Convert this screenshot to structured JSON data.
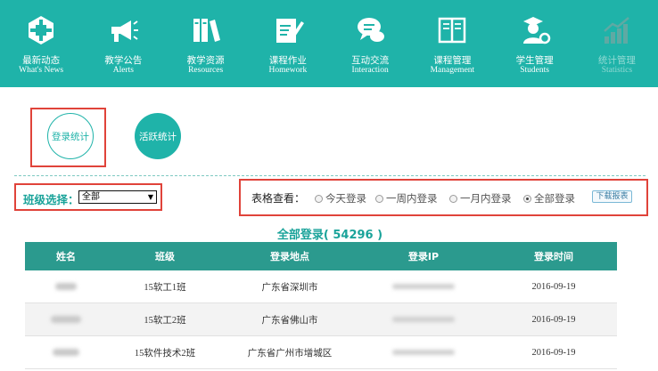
{
  "nav": [
    {
      "cn": "最新动态",
      "en": "What's News",
      "icon": "news-icon",
      "active": true
    },
    {
      "cn": "教学公告",
      "en": "Alerts",
      "icon": "megaphone-icon",
      "active": true
    },
    {
      "cn": "教学资源",
      "en": "Resources",
      "icon": "books-icon",
      "active": true
    },
    {
      "cn": "课程作业",
      "en": "Homework",
      "icon": "homework-pen-icon",
      "active": true
    },
    {
      "cn": "互动交流",
      "en": "Interaction",
      "icon": "chat-icon",
      "active": true
    },
    {
      "cn": "课程管理",
      "en": "Management",
      "icon": "open-book-icon",
      "active": true
    },
    {
      "cn": "学生管理",
      "en": "Students",
      "icon": "student-gear-icon",
      "active": true
    },
    {
      "cn": "统计管理",
      "en": "Statistics",
      "icon": "bar-chart-icon",
      "active": false
    }
  ],
  "stats": {
    "login_stats": "登录统计",
    "active_stats": "活跃统计"
  },
  "filters": {
    "class_label": "班级选择：",
    "class_selected": "全部",
    "view_label": "表格查看：",
    "options": [
      "今天登录",
      "一周内登录",
      "一月内登录",
      "全部登录"
    ],
    "selected_index": 3,
    "download_label": "下载报表"
  },
  "table": {
    "title": "全部登录( 54296 )",
    "headers": [
      "姓名",
      "班级",
      "登录地点",
      "登录IP",
      "登录时间"
    ],
    "rows": [
      {
        "class": "15软工1班",
        "location": "广东省深圳市",
        "time": "2016-09-19"
      },
      {
        "class": "15软工2班",
        "location": "广东省佛山市",
        "time": "2016-09-19"
      },
      {
        "class": "15软件技术2班",
        "location": "广东省广州市增城区",
        "time": "2016-09-19"
      }
    ]
  },
  "colors": {
    "brand": "#1fb3a9",
    "header_row": "#2b9a8e",
    "highlight_border": "#e0433a"
  }
}
